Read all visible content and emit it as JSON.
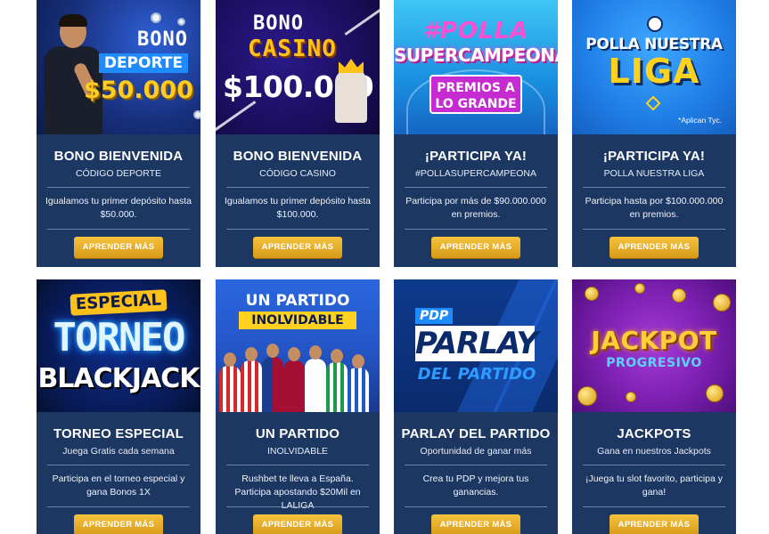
{
  "cards": [
    {
      "banner": {
        "line1": "BONO",
        "line2": "DEPORTE",
        "amount": "$50.000"
      },
      "title": "BONO BIENVENIDA",
      "subtitle": "CÓDIGO DEPORTE",
      "description": "Igualamos tu primer depósito hasta $50.000.",
      "button_label": "APRENDER MÁS"
    },
    {
      "banner": {
        "line1": "BONO",
        "line2": "CASINO",
        "amount": "$100.000"
      },
      "title": "BONO BIENVENIDA",
      "subtitle": "CÓDIGO CASINO",
      "description": "Igualamos tu primer depósito hasta $100.000.",
      "button_label": "APRENDER MÁS"
    },
    {
      "banner": {
        "line1": "#POLLA",
        "line2": "SUPERCAMPEONA",
        "box": "PREMIOS A LO GRANDE"
      },
      "title": "¡PARTICIPA YA!",
      "subtitle": "#POLLASUPERCAMPEONA",
      "description": "Participa por más de $90.000.000 en premios.",
      "button_label": "APRENDER MÁS"
    },
    {
      "banner": {
        "line1": "POLLA NUESTRA",
        "line2": "LIGA",
        "note": "*Aplican Tyc."
      },
      "title": "¡PARTICIPA YA!",
      "subtitle": "POLLA NUESTRA LIGA",
      "description": "Participa hasta por $100.000.000 en premios.",
      "button_label": "APRENDER MÁS"
    },
    {
      "banner": {
        "line1": "ESPECIAL",
        "line2": "TORNEO",
        "line3": "BLACKJACK"
      },
      "title": "TORNEO ESPECIAL",
      "subtitle": "Juega Gratis cada semana",
      "description": "Participa en el torneo especial y gana Bonos 1X",
      "button_label": "APRENDER MÁS"
    },
    {
      "banner": {
        "line1": "UN PARTIDO",
        "line2": "INOLVIDABLE"
      },
      "title": "UN PARTIDO",
      "subtitle": "INOLVIDABLE",
      "description": "Rushbet te lleva a España. Participa apostando $20Mil en LALIGA",
      "button_label": "APRENDER MÁS"
    },
    {
      "banner": {
        "line1": "PDP",
        "line2": "PARLAY",
        "line3": "DEL PARTIDO"
      },
      "title": "PARLAY DEL PARTIDO",
      "subtitle": "Oportunidad de ganar más",
      "description": "Crea tu PDP y mejora tus ganancias.",
      "button_label": "APRENDER MÁS"
    },
    {
      "banner": {
        "line1": "JACKPOT",
        "line2": "PROGRESIVO"
      },
      "title": "JACKPOTS",
      "subtitle": "Gana en nuestros Jackpots",
      "description": "¡Juega tu slot favorito, participa y gana!",
      "button_label": "APRENDER MÁS"
    }
  ],
  "colors": {
    "card_bg": "#1d3763",
    "button": "#e5a822",
    "page_bg": "#ffffff"
  }
}
